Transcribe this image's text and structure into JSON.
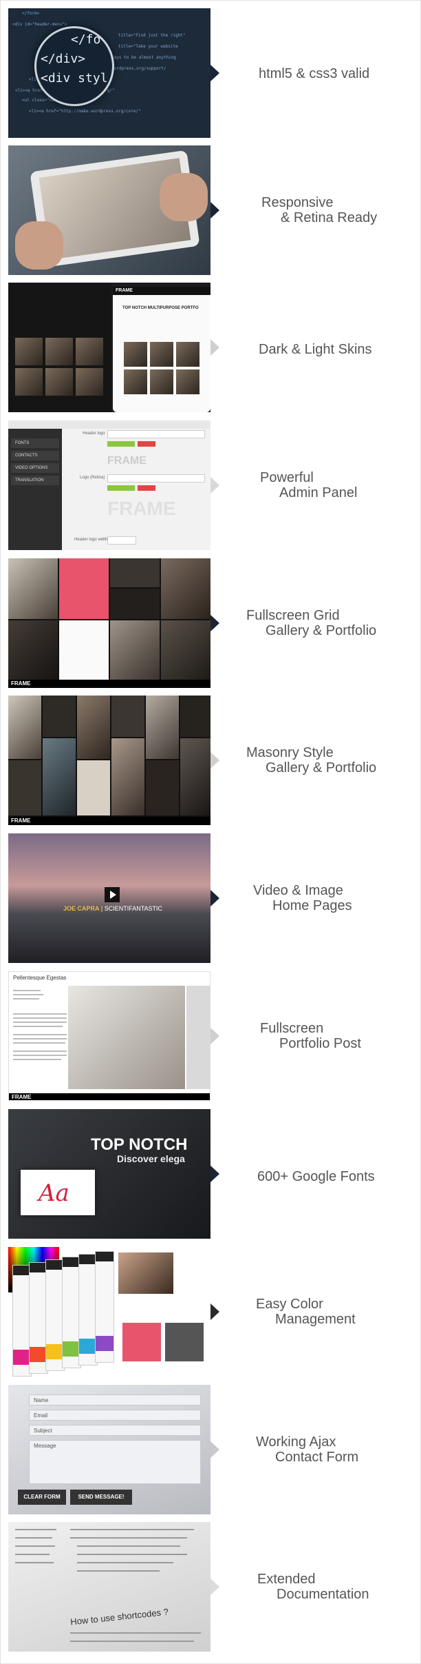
{
  "colors": {
    "arrow": "#1a2433",
    "label": "#555555"
  },
  "features": [
    {
      "l1": "html5 & css3 valid",
      "l2": ""
    },
    {
      "l1": "Responsive",
      "l2": "& Retina Ready"
    },
    {
      "l1": "Dark & Light Skins",
      "l2": ""
    },
    {
      "l1": "Powerful",
      "l2": "Admin Panel"
    },
    {
      "l1": "Fullscreen Grid",
      "l2": "Gallery & Portfolio"
    },
    {
      "l1": "Masonry Style",
      "l2": "Gallery & Portfolio"
    },
    {
      "l1": "Video & Image",
      "l2": "Home Pages"
    },
    {
      "l1": "Fullscreen",
      "l2": "Portfolio Post"
    },
    {
      "l1": "600+ Google Fonts",
      "l2": ""
    },
    {
      "l1": "Easy Color",
      "l2": "Management"
    },
    {
      "l1": "Working Ajax",
      "l2": "Contact Form"
    },
    {
      "l1": "Extended",
      "l2": "Documentation"
    }
  ],
  "code_thumb": {
    "lens_line1": "</fo",
    "lens_line2": "</div>",
    "lens_line3": "<div styl"
  },
  "skins_thumb": {
    "headline": "TOP NOTCH MULTIPURPOSE PORTFO",
    "logo": "FRAME"
  },
  "admin_thumb": {
    "menu": [
      "FONTS",
      "CONTACTS",
      "VIDEO OPTIONS",
      "TRANSLATION"
    ],
    "header_logo": "Header logo",
    "logo_retina": "Logo (Retina)",
    "header_logo_width": "Header logo width",
    "frame_text": "FRAME"
  },
  "grid_thumb": {
    "logo": "FRAME"
  },
  "masonry_thumb": {
    "logo": "FRAME"
  },
  "video_thumb": {
    "name": "JOE CAPRA",
    "subtitle": "SCIENTIFANTASTIC"
  },
  "post_thumb": {
    "title": "Pellentesque Egestas",
    "logo": "FRAME"
  },
  "fonts_thumb": {
    "line1": "TOP NOTCH",
    "line2": "Discover elega",
    "sample": "Aa"
  },
  "form_thumb": {
    "fields": [
      "Name",
      "Email",
      "Subject",
      "Message"
    ],
    "clear": "CLEAR FORM",
    "send": "SEND MESSAGE!"
  },
  "docs_thumb": {
    "heading": "How to use shortcodes ?"
  }
}
